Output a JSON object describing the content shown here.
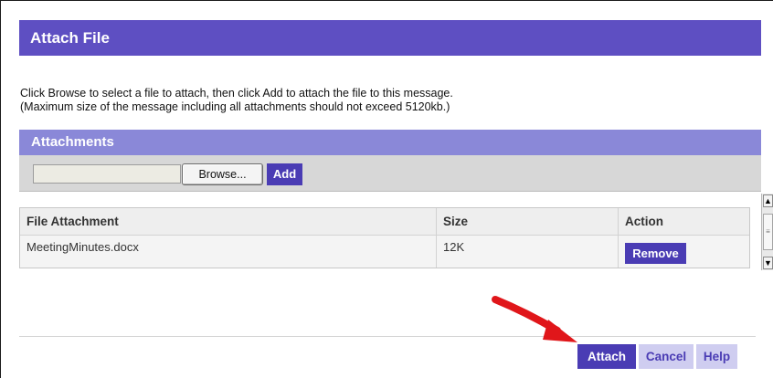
{
  "dialog": {
    "title": "Attach File"
  },
  "instructions": {
    "line1": "Click Browse to select a file to attach, then click Add to attach the file to this message.",
    "line2": "(Maximum size of the message including all attachments should not exceed 5120kb.)"
  },
  "attachments": {
    "header": "Attachments",
    "file_input_value": "",
    "browse_label": "Browse...",
    "add_label": "Add",
    "table": {
      "columns": [
        "File Attachment",
        "Size",
        "Action"
      ],
      "rows": [
        {
          "name": "MeetingMinutes.docx",
          "size": "12K",
          "action": "Remove"
        }
      ]
    }
  },
  "footer": {
    "attach_label": "Attach",
    "cancel_label": "Cancel",
    "help_label": "Help"
  },
  "colors": {
    "title_bar": "#5e4fc2",
    "section_header": "#8a88d8",
    "primary_button": "#4a3cb4",
    "secondary_button": "#cfcdf0",
    "arrow": "#e0161a"
  }
}
